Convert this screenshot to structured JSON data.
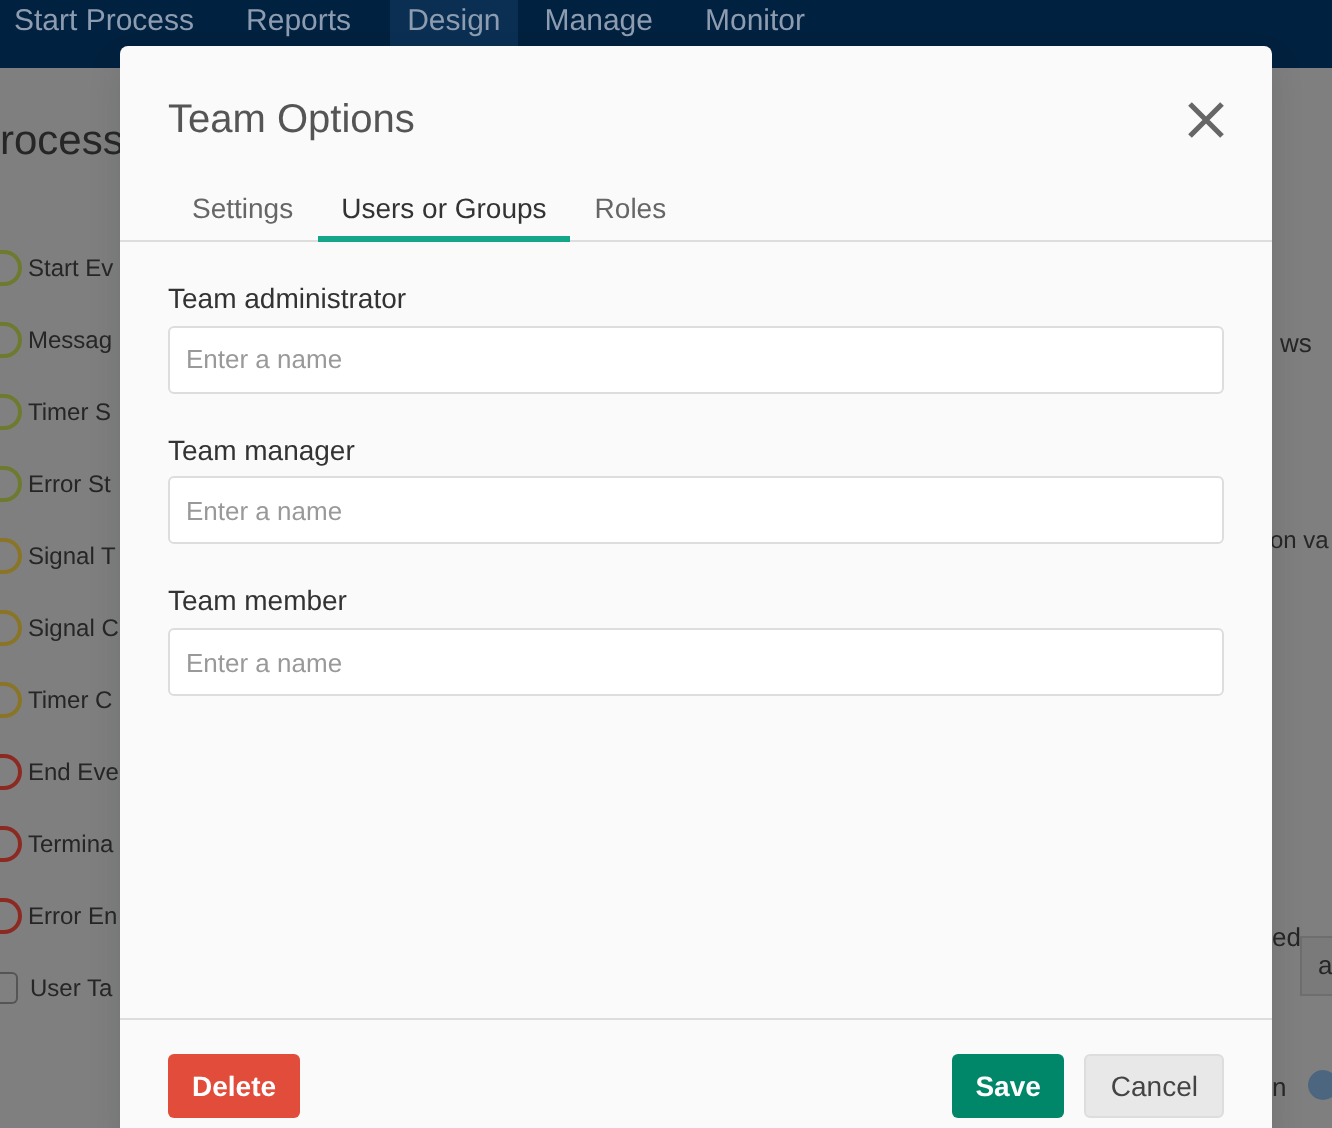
{
  "nav_items": [
    {
      "label": "Start Process",
      "selected": false
    },
    {
      "label": "Reports",
      "selected": false
    },
    {
      "label": "Design",
      "selected": true
    },
    {
      "label": "Manage",
      "selected": false
    },
    {
      "label": "Monitor",
      "selected": false
    }
  ],
  "page_title": "rocess",
  "palette": [
    {
      "kind": "event",
      "label": "Start Ev",
      "color": "#6e7a2e"
    },
    {
      "kind": "event",
      "label": "Messag",
      "color": "#6e7a2e"
    },
    {
      "kind": "event",
      "label": "Timer S",
      "color": "#6e7a2e"
    },
    {
      "kind": "event",
      "label": "Error St",
      "color": "#6e7a2e"
    },
    {
      "kind": "event",
      "label": "Signal T",
      "color": "#8a7526"
    },
    {
      "kind": "event",
      "label": "Signal C",
      "color": "#8a7526"
    },
    {
      "kind": "event",
      "label": "Timer C",
      "color": "#8a7526"
    },
    {
      "kind": "event",
      "label": "End Eve",
      "color": "#8c2a22"
    },
    {
      "kind": "event",
      "label": "Termina",
      "color": "#8c2a22"
    },
    {
      "kind": "event",
      "label": "Error En",
      "color": "#8c2a22"
    },
    {
      "kind": "task",
      "label": "User Ta"
    }
  ],
  "right_panel": {
    "heading": "ws",
    "text": "on va",
    "option_label": "ed",
    "field_value": "a",
    "help_label": "n"
  },
  "modal": {
    "title": "Team Options",
    "tabs": [
      {
        "label": "Settings",
        "selected": false
      },
      {
        "label": "Users or Groups",
        "selected": true
      },
      {
        "label": "Roles",
        "selected": false
      }
    ],
    "fields": [
      {
        "label": "Team administrator",
        "placeholder": "Enter a name"
      },
      {
        "label": "Team manager",
        "placeholder": "Enter a name"
      },
      {
        "label": "Team member",
        "placeholder": "Enter a name"
      }
    ],
    "buttons": [
      {
        "kind": "danger",
        "label": "Delete"
      },
      {
        "kind": "primary",
        "label": "Save"
      },
      {
        "kind": "secondary",
        "label": "Cancel"
      }
    ]
  }
}
